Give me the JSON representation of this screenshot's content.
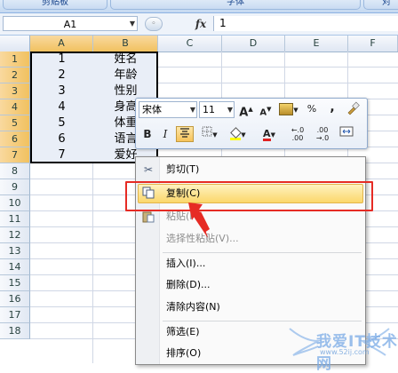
{
  "ribbon": {
    "groups": [
      "剪贴板",
      "字体",
      "对"
    ]
  },
  "formula_bar": {
    "name_box": "A1",
    "fx_label": "fx",
    "content": "1"
  },
  "columns": [
    "A",
    "B",
    "C",
    "D",
    "E",
    "F"
  ],
  "rows": [
    "1",
    "2",
    "3",
    "4",
    "5",
    "6",
    "7",
    "8",
    "9",
    "10",
    "11",
    "12",
    "13",
    "14",
    "15",
    "16",
    "17",
    "18"
  ],
  "cells": {
    "A": [
      "1",
      "2",
      "3",
      "4",
      "5",
      "6",
      "7"
    ],
    "B": [
      "姓名",
      "年龄",
      "性别",
      "身高",
      "体重",
      "语言",
      "爱好"
    ]
  },
  "mini_toolbar": {
    "font_name": "宋体",
    "font_size": "11",
    "grow_font": "A",
    "shrink_font": "A",
    "percent": "%",
    "comma": ",",
    "bold": "B",
    "italic": "I",
    "font_color": "A",
    "inc_decimal": "←.0 .00",
    "dec_decimal": ".00 →.0"
  },
  "context_menu": {
    "items": [
      {
        "label": "剪切(T)",
        "enabled": true
      },
      {
        "label": "复制(C)",
        "enabled": true,
        "highlighted": true
      },
      {
        "label": "粘贴(P)",
        "enabled": false
      },
      {
        "label": "选择性粘贴(V)...",
        "enabled": false
      },
      {
        "label": "插入(I)...",
        "enabled": true
      },
      {
        "label": "删除(D)...",
        "enabled": true
      },
      {
        "label": "清除内容(N)",
        "enabled": true
      },
      {
        "label": "筛选(E)",
        "enabled": true
      },
      {
        "label": "排序(O)",
        "enabled": true
      }
    ]
  },
  "watermark": {
    "text": "我爱IT技术网",
    "url": "www.52ij.com"
  },
  "colors": {
    "selection_border": "#000000",
    "highlight": "#fbd76b",
    "annotation_red": "#e62b24"
  }
}
